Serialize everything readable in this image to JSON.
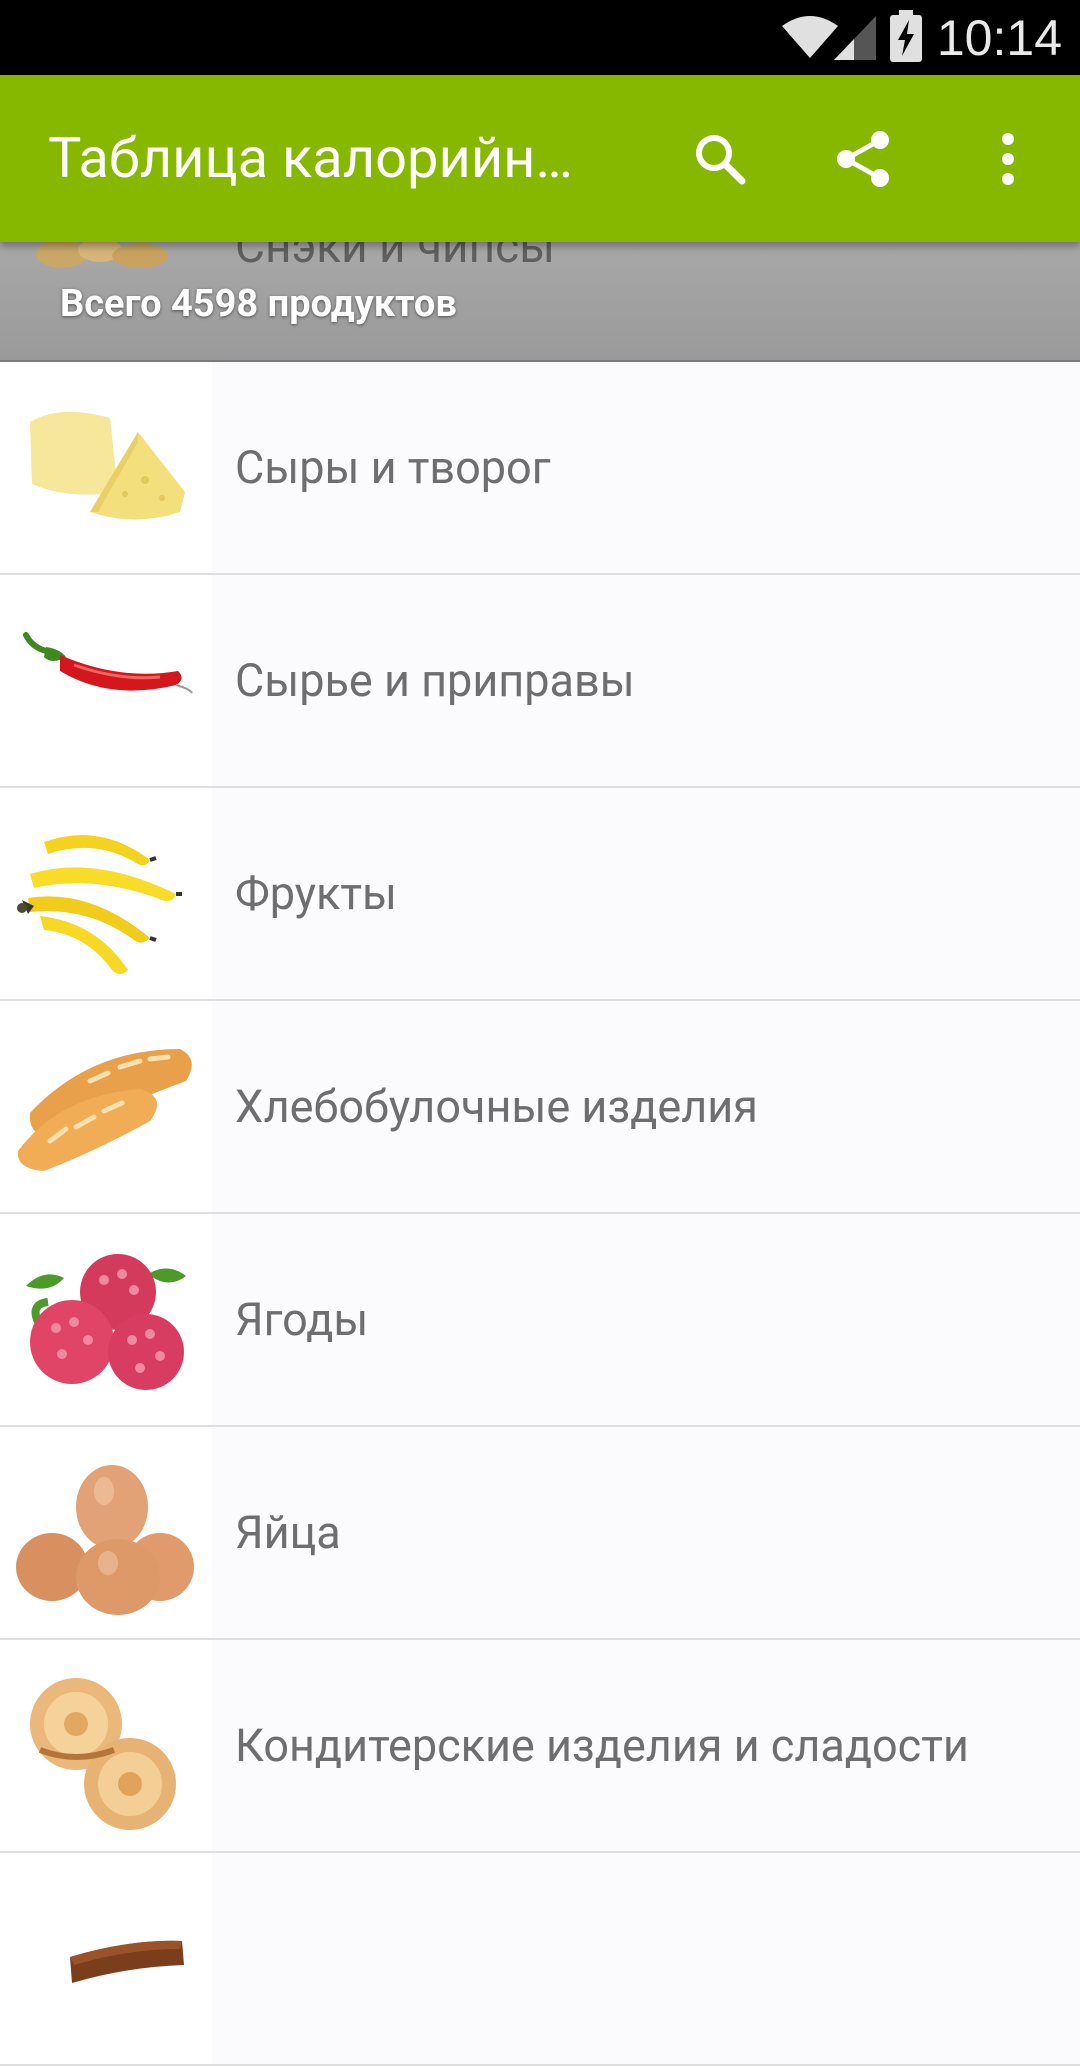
{
  "status_bar": {
    "time": "10:14",
    "icons": [
      "wifi-icon",
      "signal-icon",
      "battery-charging-icon"
    ]
  },
  "app_bar": {
    "title": "Таблица калорийн…",
    "actions": [
      "search-icon",
      "share-icon",
      "more-vert-icon"
    ],
    "color": "#86b800"
  },
  "header": {
    "behind_item": "Снэки и чипсы",
    "total_text": "Всего 4598 продуктов"
  },
  "categories": [
    {
      "label": "Сыры и творог",
      "icon": "cheese-icon"
    },
    {
      "label": "Сырье и приправы",
      "icon": "chili-pepper-icon"
    },
    {
      "label": "Фрукты",
      "icon": "banana-icon"
    },
    {
      "label": "Хлебобулочные изделия",
      "icon": "bread-icon"
    },
    {
      "label": "Ягоды",
      "icon": "raspberry-icon"
    },
    {
      "label": "Яйца",
      "icon": "eggs-icon"
    },
    {
      "label": "Кондитерские изделия и сладости",
      "icon": "cookies-icon"
    },
    {
      "label": "",
      "icon": "chocolate-icon"
    }
  ]
}
